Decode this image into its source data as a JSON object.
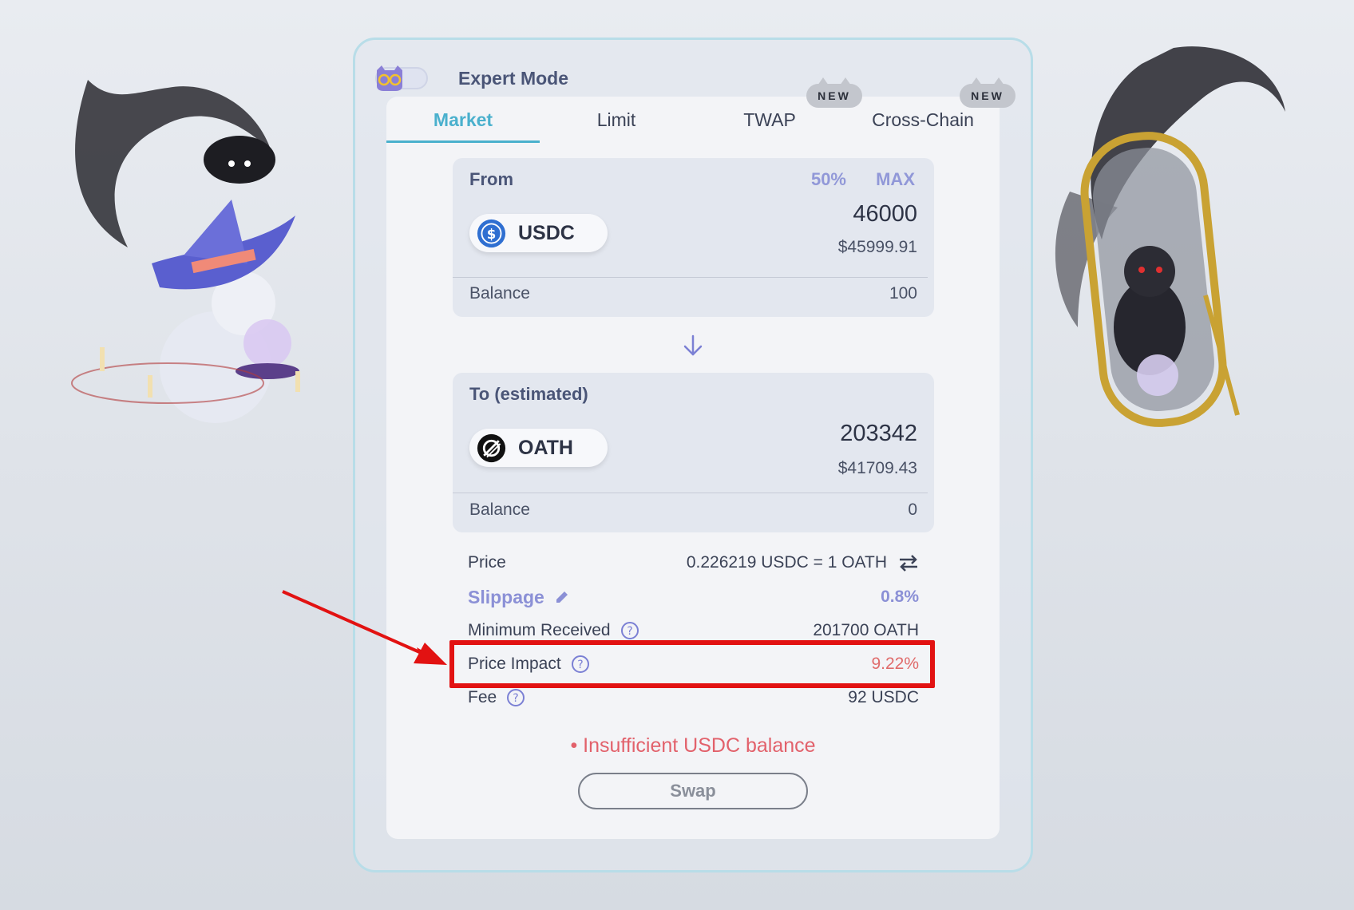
{
  "expert_mode": {
    "label": "Expert Mode"
  },
  "tabs": [
    {
      "label": "Market"
    },
    {
      "label": "Limit"
    },
    {
      "label": "TWAP"
    },
    {
      "label": "Cross-Chain"
    }
  ],
  "badges": {
    "new": "NEW"
  },
  "from_panel": {
    "title": "From",
    "half_label": "50%",
    "max_label": "MAX",
    "token": "USDC",
    "amount": "46000",
    "usd_value": "$45999.91",
    "balance_label": "Balance",
    "balance": "100"
  },
  "to_panel": {
    "title": "To (estimated)",
    "token": "OATH",
    "amount": "203342",
    "usd_value": "$41709.43",
    "balance_label": "Balance",
    "balance": "0"
  },
  "details": {
    "price_label": "Price",
    "price_value": "0.226219 USDC = 1 OATH",
    "slippage_label": "Slippage",
    "slippage_value": "0.8%",
    "min_received_label": "Minimum Received",
    "min_received_value": "201700 OATH",
    "price_impact_label": "Price Impact",
    "price_impact_value": "9.22%",
    "fee_label": "Fee",
    "fee_value": "92 USDC"
  },
  "error": "• Insufficient USDC balance",
  "swap_button": "Swap",
  "colors": {
    "accent": "#4ab0cd",
    "purple": "#8b90d6",
    "error": "#e2616b",
    "highlight": "#e21212"
  }
}
